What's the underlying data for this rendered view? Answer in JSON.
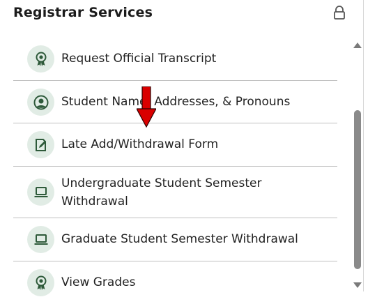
{
  "panel": {
    "title": "Registrar Services",
    "lock_icon": "lock-icon"
  },
  "items": [
    {
      "label": "Request Official Transcript",
      "icon": "award-icon"
    },
    {
      "label": "Student Name, Addresses, & Pronouns",
      "icon": "user-circle-icon"
    },
    {
      "label": "Late Add/Withdrawal Form",
      "icon": "edit-document-icon"
    },
    {
      "label": "Undergraduate Student Semester Withdrawal",
      "icon": "laptop-icon"
    },
    {
      "label": "Graduate Student Semester Withdrawal",
      "icon": "laptop-icon"
    },
    {
      "label": "View Grades",
      "icon": "award-icon"
    }
  ],
  "colors": {
    "icon_bg": "#e1ece5",
    "icon_fg": "#2e5a3a",
    "annotation_arrow": "#d90000"
  }
}
